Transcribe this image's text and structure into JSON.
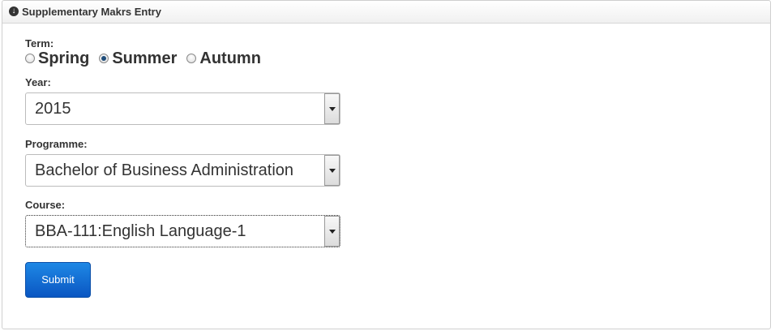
{
  "panel": {
    "title": "Supplementary Makrs Entry",
    "header_icon": "circle-arrow-down-icon"
  },
  "form": {
    "term_label": "Term:",
    "term_options": [
      {
        "label": "Spring",
        "checked": false
      },
      {
        "label": "Summer",
        "checked": true
      },
      {
        "label": "Autumn",
        "checked": false
      }
    ],
    "year_label": "Year:",
    "year_value": "2015",
    "programme_label": "Programme:",
    "programme_value": "Bachelor of Business Administration",
    "course_label": "Course:",
    "course_value": "BBA-111:English Language-1",
    "submit_label": "Submit"
  },
  "colors": {
    "submit_button": "#0a56c2",
    "radio_checked": "#1f4d7a"
  }
}
